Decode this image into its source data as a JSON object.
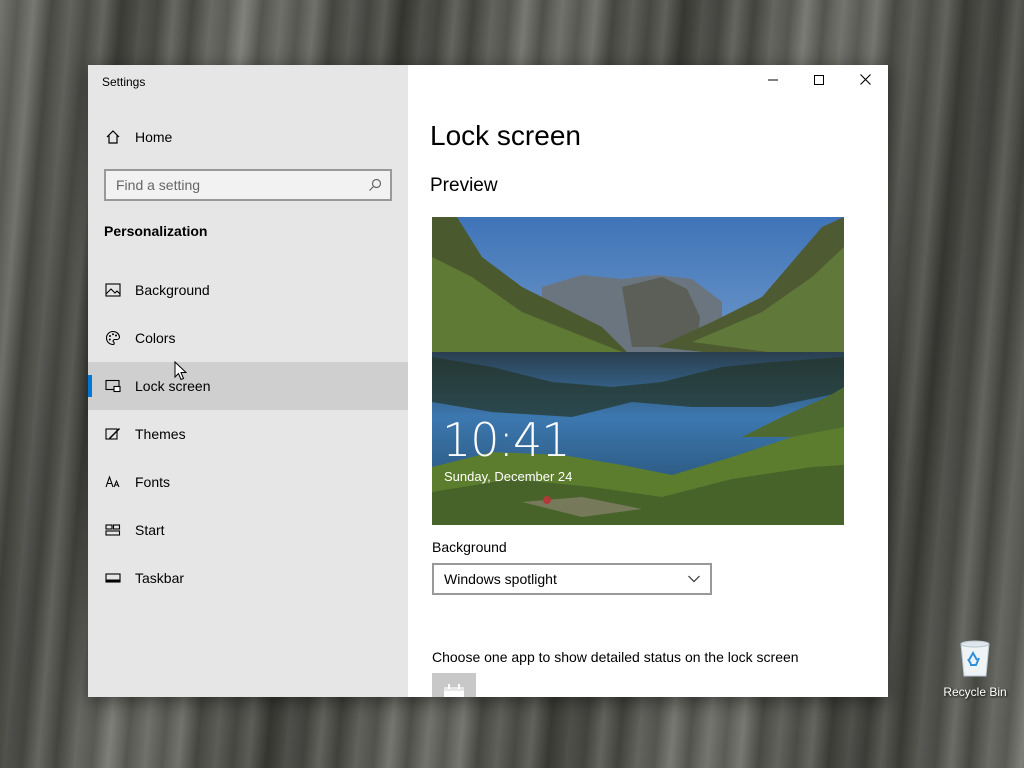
{
  "window": {
    "title": "Settings",
    "controls": [
      "minimize-icon",
      "maximize-icon",
      "close-icon"
    ]
  },
  "sidebar": {
    "home_label": "Home",
    "search_placeholder": "Find a setting",
    "section_title": "Personalization",
    "items": [
      {
        "label": "Background",
        "icon": "picture-icon"
      },
      {
        "label": "Colors",
        "icon": "palette-icon"
      },
      {
        "label": "Lock screen",
        "icon": "lock-screen-icon",
        "active": true
      },
      {
        "label": "Themes",
        "icon": "brush-icon"
      },
      {
        "label": "Fonts",
        "icon": "fonts-icon"
      },
      {
        "label": "Start",
        "icon": "start-icon"
      },
      {
        "label": "Taskbar",
        "icon": "taskbar-icon"
      }
    ]
  },
  "content": {
    "page_title": "Lock screen",
    "preview_title": "Preview",
    "preview": {
      "time": "10:41",
      "date": "Sunday, December 24"
    },
    "background_label": "Background",
    "background_value": "Windows spotlight",
    "status_label": "Choose one app to show detailed status on the lock screen"
  },
  "desktop": {
    "recycle_bin_label": "Recycle Bin"
  },
  "colors": {
    "accent": "#0078d7",
    "sidebar_bg": "#e6e6e6",
    "active_item_bg": "#cfcfcf"
  }
}
